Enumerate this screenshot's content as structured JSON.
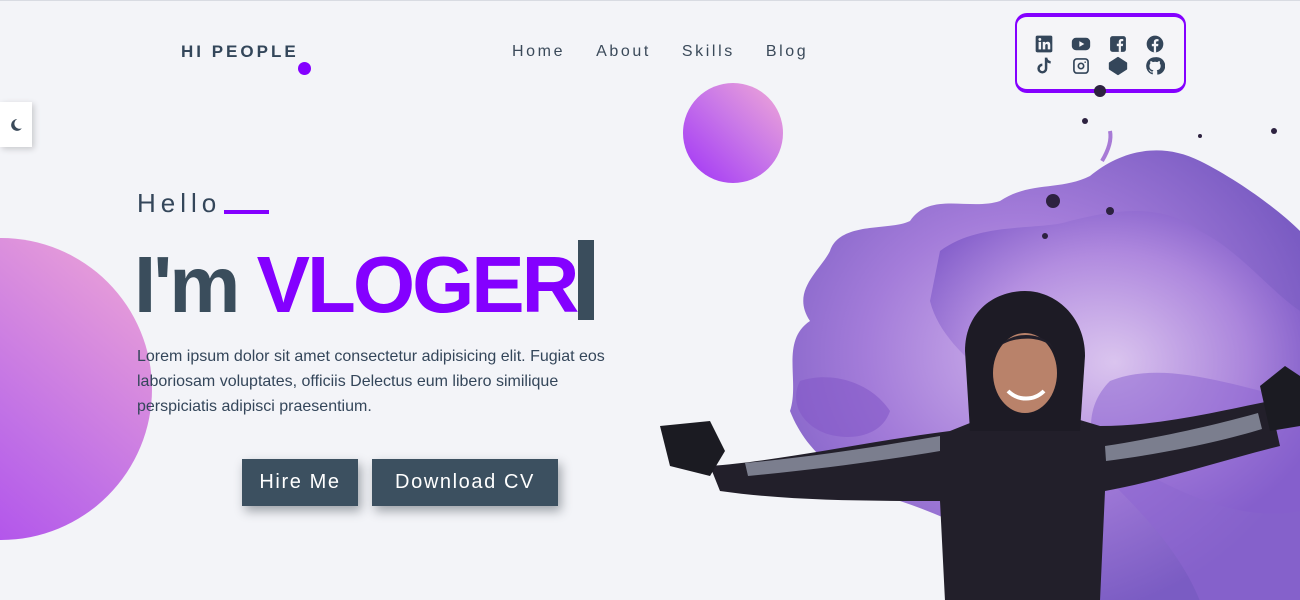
{
  "header": {
    "brand": "HI PEOPLE",
    "nav": [
      "Home",
      "About",
      "Skills",
      "Blog"
    ]
  },
  "social_icons": [
    "linkedin-icon",
    "youtube-icon",
    "facebook-square-icon",
    "facebook-icon",
    "tiktok-icon",
    "instagram-icon",
    "codepen-icon",
    "github-icon"
  ],
  "theme_toggle_icon": "moon-icon",
  "hero": {
    "greeting": "Hello",
    "headline_prefix": "I'm ",
    "headline_accent": "VLOGER",
    "bio": "Lorem ipsum dolor sit amet consectetur adipisicing elit. Fugiat eos laboriosam voluptates, officiis Delectus eum libero similique perspiciatis adipisci praesentium.",
    "buttons": {
      "hire": "Hire Me",
      "download": "Download CV"
    }
  },
  "colors": {
    "accent": "#8400ff",
    "text": "#3a4d5c",
    "background": "#f3f4f8",
    "button": "#3c5060"
  }
}
